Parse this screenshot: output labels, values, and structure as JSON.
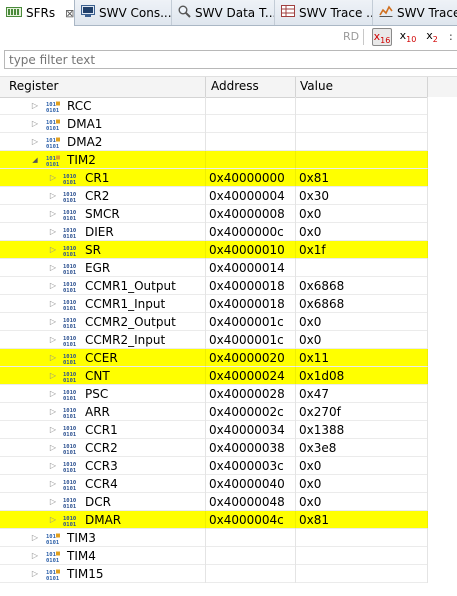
{
  "tabs": [
    {
      "label": "SFRs",
      "icon": "sfr-icon",
      "active": true,
      "close": "⊠"
    },
    {
      "label": "SWV Cons...",
      "icon": "console-icon"
    },
    {
      "label": "SWV Data T...",
      "icon": "search-icon"
    },
    {
      "label": "SWV Trace ...",
      "icon": "table-icon"
    },
    {
      "label": "SWV Trace",
      "icon": "graph-icon"
    }
  ],
  "toolbar": {
    "rd": "RD",
    "hex": {
      "main": "x",
      "sub": "16"
    },
    "dec": {
      "main": "x",
      "sub": "10"
    },
    "bin": {
      "main": "x",
      "sub": "2"
    },
    "more": ":"
  },
  "filter": {
    "placeholder": "type filter text",
    "value": ""
  },
  "columns": {
    "register": "Register",
    "address": "Address",
    "value": "Value"
  },
  "colors": {
    "highlight": "#ffff00"
  },
  "rows": [
    {
      "name": "RCC",
      "level": 0,
      "expanded": false,
      "address": "",
      "value": "",
      "highlight": false,
      "icon": "peripheral-icon"
    },
    {
      "name": "DMA1",
      "level": 0,
      "expanded": false,
      "address": "",
      "value": "",
      "highlight": false,
      "icon": "peripheral-icon"
    },
    {
      "name": "DMA2",
      "level": 0,
      "expanded": false,
      "address": "",
      "value": "",
      "highlight": false,
      "icon": "peripheral-icon"
    },
    {
      "name": "TIM2",
      "level": 0,
      "expanded": true,
      "address": "",
      "value": "",
      "highlight": true,
      "icon": "peripheral-icon"
    },
    {
      "name": "CR1",
      "level": 1,
      "address": "0x40000000",
      "value": "0x81",
      "highlight": true,
      "icon": "register-icon"
    },
    {
      "name": "CR2",
      "level": 1,
      "address": "0x40000004",
      "value": "0x30",
      "highlight": false,
      "icon": "register-icon"
    },
    {
      "name": "SMCR",
      "level": 1,
      "address": "0x40000008",
      "value": "0x0",
      "highlight": false,
      "icon": "register-icon"
    },
    {
      "name": "DIER",
      "level": 1,
      "address": "0x4000000c",
      "value": "0x0",
      "highlight": false,
      "icon": "register-icon"
    },
    {
      "name": "SR",
      "level": 1,
      "address": "0x40000010",
      "value": "0x1f",
      "highlight": true,
      "icon": "register-icon"
    },
    {
      "name": "EGR",
      "level": 1,
      "address": "0x40000014",
      "value": "",
      "highlight": false,
      "icon": "register-icon"
    },
    {
      "name": "CCMR1_Output",
      "level": 1,
      "address": "0x40000018",
      "value": "0x6868",
      "highlight": false,
      "icon": "register-icon"
    },
    {
      "name": "CCMR1_Input",
      "level": 1,
      "address": "0x40000018",
      "value": "0x6868",
      "highlight": false,
      "icon": "register-icon"
    },
    {
      "name": "CCMR2_Output",
      "level": 1,
      "address": "0x4000001c",
      "value": "0x0",
      "highlight": false,
      "icon": "register-icon"
    },
    {
      "name": "CCMR2_Input",
      "level": 1,
      "address": "0x4000001c",
      "value": "0x0",
      "highlight": false,
      "icon": "register-icon"
    },
    {
      "name": "CCER",
      "level": 1,
      "address": "0x40000020",
      "value": "0x11",
      "highlight": true,
      "icon": "register-icon"
    },
    {
      "name": "CNT",
      "level": 1,
      "address": "0x40000024",
      "value": "0x1d08",
      "highlight": true,
      "icon": "register-icon"
    },
    {
      "name": "PSC",
      "level": 1,
      "address": "0x40000028",
      "value": "0x47",
      "highlight": false,
      "icon": "register-icon"
    },
    {
      "name": "ARR",
      "level": 1,
      "address": "0x4000002c",
      "value": "0x270f",
      "highlight": false,
      "icon": "register-icon"
    },
    {
      "name": "CCR1",
      "level": 1,
      "address": "0x40000034",
      "value": "0x1388",
      "highlight": false,
      "icon": "register-icon"
    },
    {
      "name": "CCR2",
      "level": 1,
      "address": "0x40000038",
      "value": "0x3e8",
      "highlight": false,
      "icon": "register-icon"
    },
    {
      "name": "CCR3",
      "level": 1,
      "address": "0x4000003c",
      "value": "0x0",
      "highlight": false,
      "icon": "register-icon"
    },
    {
      "name": "CCR4",
      "level": 1,
      "address": "0x40000040",
      "value": "0x0",
      "highlight": false,
      "icon": "register-icon"
    },
    {
      "name": "DCR",
      "level": 1,
      "address": "0x40000048",
      "value": "0x0",
      "highlight": false,
      "icon": "register-icon"
    },
    {
      "name": "DMAR",
      "level": 1,
      "address": "0x4000004c",
      "value": "0x81",
      "highlight": true,
      "icon": "register-icon"
    },
    {
      "name": "TIM3",
      "level": 0,
      "expanded": false,
      "address": "",
      "value": "",
      "highlight": false,
      "icon": "peripheral-icon"
    },
    {
      "name": "TIM4",
      "level": 0,
      "expanded": false,
      "address": "",
      "value": "",
      "highlight": false,
      "icon": "peripheral-icon"
    },
    {
      "name": "TIM15",
      "level": 0,
      "expanded": false,
      "address": "",
      "value": "",
      "highlight": false,
      "icon": "peripheral-icon"
    }
  ]
}
